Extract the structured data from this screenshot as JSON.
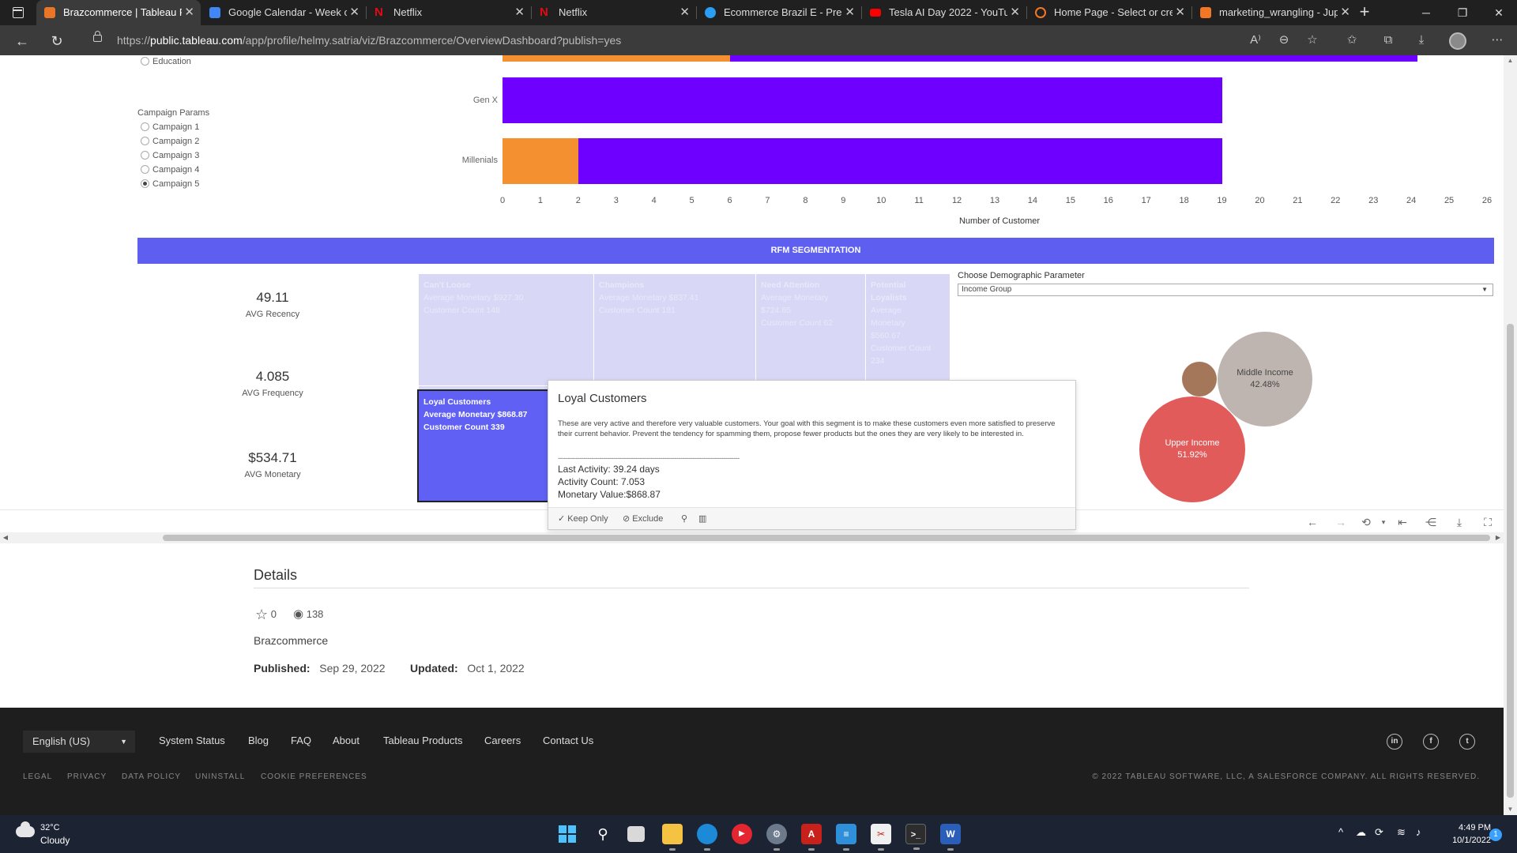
{
  "browser": {
    "tabs": [
      {
        "title": "Brazcommerce | Tableau P...",
        "favicon_color": "#e97627",
        "active": true
      },
      {
        "title": "Google Calendar - Week o...",
        "favicon_color": "#4285f4",
        "active": false
      },
      {
        "title": "Netflix",
        "favicon_color": "#e50914",
        "active": false
      },
      {
        "title": "Netflix",
        "favicon_color": "#e50914",
        "active": false
      },
      {
        "title": "Ecommerce Brazil E - Prese...",
        "favicon_color": "#2a9df4",
        "active": false
      },
      {
        "title": "Tesla AI Day 2022 - YouTu...",
        "favicon_color": "#ff0000",
        "active": false
      },
      {
        "title": "Home Page - Select or cre...",
        "favicon_color": "#f37626",
        "active": false
      },
      {
        "title": "marketing_wrangling - Jup...",
        "favicon_color": "#f37626",
        "active": false
      }
    ],
    "url_prefix": "https://",
    "url_domain": "public.tableau.com",
    "url_path": "/app/profile/helmy.satria/viz/Brazcommerce/OverviewDashboard?publish=yes"
  },
  "filters": {
    "education_label": "Education",
    "campaign_title": "Campaign Params",
    "campaigns": [
      {
        "label": "Campaign 1",
        "selected": false
      },
      {
        "label": "Campaign 2",
        "selected": false
      },
      {
        "label": "Campaign 3",
        "selected": false
      },
      {
        "label": "Campaign 4",
        "selected": false
      },
      {
        "label": "Campaign 5",
        "selected": true
      }
    ]
  },
  "chart_data": {
    "type": "bar",
    "orientation": "horizontal",
    "stacked": true,
    "categories": [
      "Gen X",
      "Millenials"
    ],
    "series": [
      {
        "color": "#f4902f",
        "values": [
          0,
          2
        ]
      },
      {
        "color": "#6e00ff",
        "values": [
          19,
          17
        ]
      }
    ],
    "partial_top_bar": {
      "orange": 6,
      "purple": 18
    },
    "xlabel": "Number of Customer",
    "xlim": [
      0,
      26
    ],
    "xticks": [
      0,
      1,
      2,
      3,
      4,
      5,
      6,
      7,
      8,
      9,
      10,
      11,
      12,
      13,
      14,
      15,
      16,
      17,
      18,
      19,
      20,
      21,
      22,
      23,
      24,
      25,
      26
    ]
  },
  "rfm": {
    "banner": "RFM SEGMENTATION",
    "kpis": [
      {
        "value": "49.11",
        "label": "AVG Recency"
      },
      {
        "value": "4.085",
        "label": "AVG Frequency"
      },
      {
        "value": "$534.71",
        "label": "AVG Monetary"
      }
    ],
    "segments": {
      "cant_loose": {
        "name": "Can't Loose",
        "line1": "Average Monetary $927.30",
        "line2": "Customer Count 148"
      },
      "champions": {
        "name": "Champions",
        "line1": "Average Monetary $837.41",
        "line2": "Customer Count 181"
      },
      "need_attention": {
        "name": "Need Attention",
        "line1": "Average Monetary",
        "line2": "$724.65",
        "line3": "Customer Count 62"
      },
      "potential": {
        "name": "Potential",
        "name2": "Loyalists",
        "line1": "Average",
        "line2": "Monetary",
        "line3": "$560.67",
        "line4": "Customer Count",
        "line5": "234"
      },
      "loyal": {
        "name": "Loyal Customers",
        "line1": "Average Monetary $868.87",
        "line2": "Customer Count 339"
      }
    },
    "demographic": {
      "label": "Choose Demographic Parameter",
      "selected": "Income Group"
    },
    "bubbles": [
      {
        "name": "Middle Income",
        "pct": "42.48%",
        "color": "#bfb5b0"
      },
      {
        "name": "Upper Income",
        "pct": "51.92%",
        "color": "#e25b5b"
      },
      {
        "name": "",
        "pct": "",
        "color": "#a5775a"
      }
    ],
    "colors": {
      "banner": "#5e5ef0",
      "cell": "#d8d8f6",
      "loyal": "#6060f5"
    }
  },
  "tooltip": {
    "title": "Loyal Customers",
    "description": "These are very active and therefore very valuable customers. Your goal with this segment is to make these customers even more satisfied to preserve their current behavior. Prevent the tendency for spamming them, propose fewer products but the ones they are very likely to be interested in.",
    "separator": "--------------------------------------------------------------------------------------------",
    "last_activity": "Last Activity: 39.24 days",
    "activity_count": "Activity Count: 7.053",
    "monetary_value": "Monetary Value:$868.87",
    "keep_only": "Keep Only",
    "exclude": "Exclude"
  },
  "details": {
    "title": "Details",
    "favorites": "0",
    "views": "138",
    "name": "Brazcommerce",
    "published_label": "Published:",
    "published_date": "Sep 29, 2022",
    "updated_label": "Updated:",
    "updated_date": "Oct 1, 2022"
  },
  "footer": {
    "language": "English (US)",
    "links": [
      "System Status",
      "Blog",
      "FAQ",
      "About",
      "Tableau Products",
      "Careers",
      "Contact Us"
    ],
    "legal": [
      "LEGAL",
      "PRIVACY",
      "DATA POLICY",
      "UNINSTALL",
      "COOKIE PREFERENCES"
    ],
    "copyright": "© 2022 TABLEAU SOFTWARE, LLC, A SALESFORCE COMPANY. ALL RIGHTS RESERVED."
  },
  "taskbar": {
    "temperature": "32°C",
    "weather": "Cloudy",
    "time": "4:49 PM",
    "date": "10/1/2022",
    "notifications": "1"
  }
}
